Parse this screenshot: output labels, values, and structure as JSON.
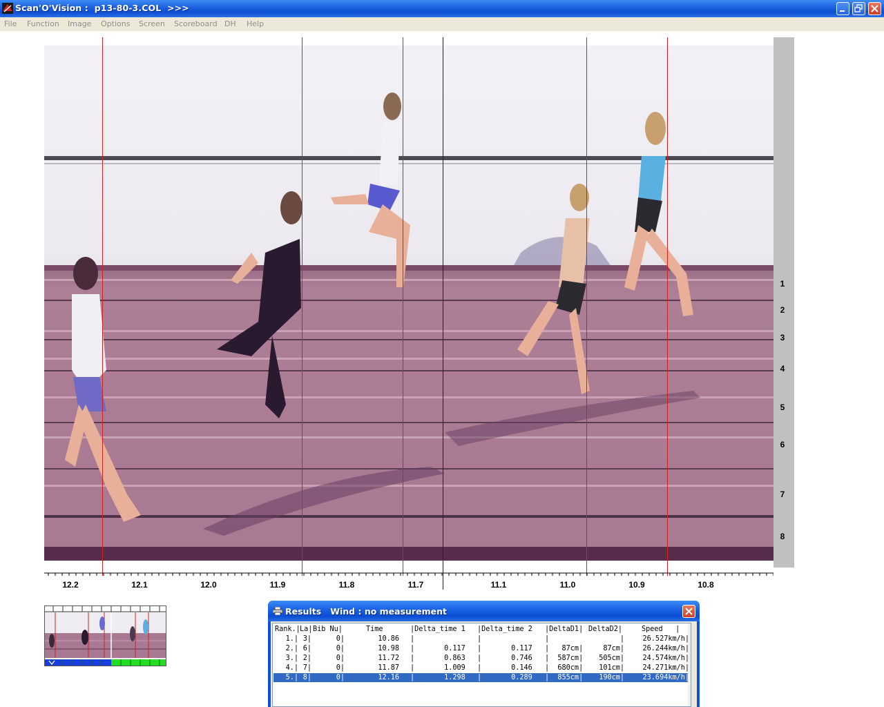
{
  "window": {
    "title": "Scan'O'Vision :  p13-80-3.COL  >>>",
    "buttons": [
      "minimize",
      "restore",
      "close"
    ]
  },
  "menu": {
    "items": [
      "File",
      "Function",
      "Image",
      "Options",
      "Screen",
      "Scoreboard",
      "DH",
      "Help"
    ]
  },
  "lanes": [
    "1",
    "2",
    "3",
    "4",
    "5",
    "6",
    "7",
    "8"
  ],
  "time_scale": {
    "labels": [
      "12.2",
      "12.1",
      "12.0",
      "11.9",
      "11.8",
      "11.7",
      "11.1",
      "11.0",
      "10.9",
      "10.8"
    ]
  },
  "results": {
    "title": "Results   Wind : no measurement",
    "header": {
      "rank": "Rank.|",
      "lane": "La|",
      "bib": "Bib Nu|",
      "time": "Time",
      "d1": "|Delta_time 1",
      "d2": "|Delta_time 2",
      "dd1": "|DeltaD1|",
      "dd2": "DeltaD2|",
      "speed": "Speed   |"
    },
    "rows": [
      {
        "rank": "1.|",
        "lane": "3|",
        "bib": "0|",
        "time": "10.86",
        "d1": "|",
        "d2": "|",
        "dd1": "|",
        "dd2": "|",
        "speed": "26.527km/h|"
      },
      {
        "rank": "2.|",
        "lane": "6|",
        "bib": "0|",
        "time": "10.98",
        "d1": "|       0.117",
        "d2": "|       0.117",
        "dd1": "|   87cm|",
        "dd2": "87cm|",
        "speed": "26.244km/h|"
      },
      {
        "rank": "3.|",
        "lane": "2|",
        "bib": "0|",
        "time": "11.72",
        "d1": "|       0.863",
        "d2": "|       0.746",
        "dd1": "|  587cm|",
        "dd2": "505cm|",
        "speed": "24.574km/h|"
      },
      {
        "rank": "4.|",
        "lane": "7|",
        "bib": "0|",
        "time": "11.87",
        "d1": "|       1.009",
        "d2": "|       0.146",
        "dd1": "|  680cm|",
        "dd2": "101cm|",
        "speed": "24.271km/h|"
      },
      {
        "rank": "5.|",
        "lane": "8|",
        "bib": "0|",
        "time": "12.16",
        "d1": "|       1.298",
        "d2": "|       0.289",
        "dd1": "|  855cm|",
        "dd2": "190cm|",
        "speed": "23.694km/h|"
      }
    ],
    "selected_rank": "5."
  },
  "colors": {
    "titlebar": "#0d4fd2",
    "track": "#a97892",
    "finish_line": "#d02020",
    "selection": "#316ac5",
    "thumb_progress_blue": "#1a3de0",
    "thumb_progress_green": "#22dd22"
  },
  "icons": {
    "app": "scanovision-logo-icon",
    "results": "printer-icon"
  }
}
